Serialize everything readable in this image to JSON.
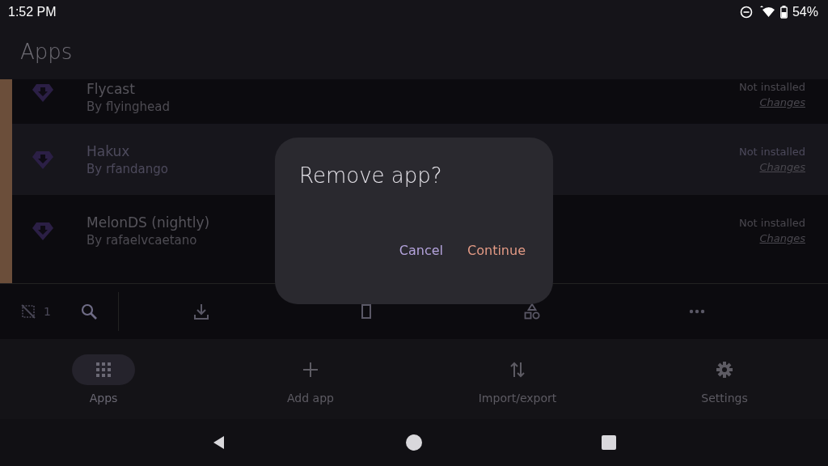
{
  "status_bar": {
    "time": "1:52 PM",
    "battery": "54%"
  },
  "app_bar": {
    "title": "Apps"
  },
  "apps": [
    {
      "name": "Flycast",
      "author": "By flyinghead",
      "status": "Not installed",
      "link": "Changes",
      "selected": false
    },
    {
      "name": "Hakux",
      "author": "By rfandango",
      "status": "Not installed",
      "link": "Changes",
      "selected": true
    },
    {
      "name": "MelonDS (nightly)",
      "author": "By rafaelvcaetano",
      "status": "Not installed",
      "link": "Changes",
      "selected": false
    }
  ],
  "selection_toolbar": {
    "count": "1"
  },
  "dialog": {
    "title": "Remove app?",
    "buttons": [
      {
        "label": "Cancel",
        "kind": "dismiss"
      },
      {
        "label": "Continue",
        "kind": "confirm"
      }
    ]
  },
  "bottom_nav": [
    {
      "label": "Apps",
      "selected": true
    },
    {
      "label": "Add app",
      "selected": false
    },
    {
      "label": "Import/export",
      "selected": false
    },
    {
      "label": "Settings",
      "selected": false
    }
  ]
}
